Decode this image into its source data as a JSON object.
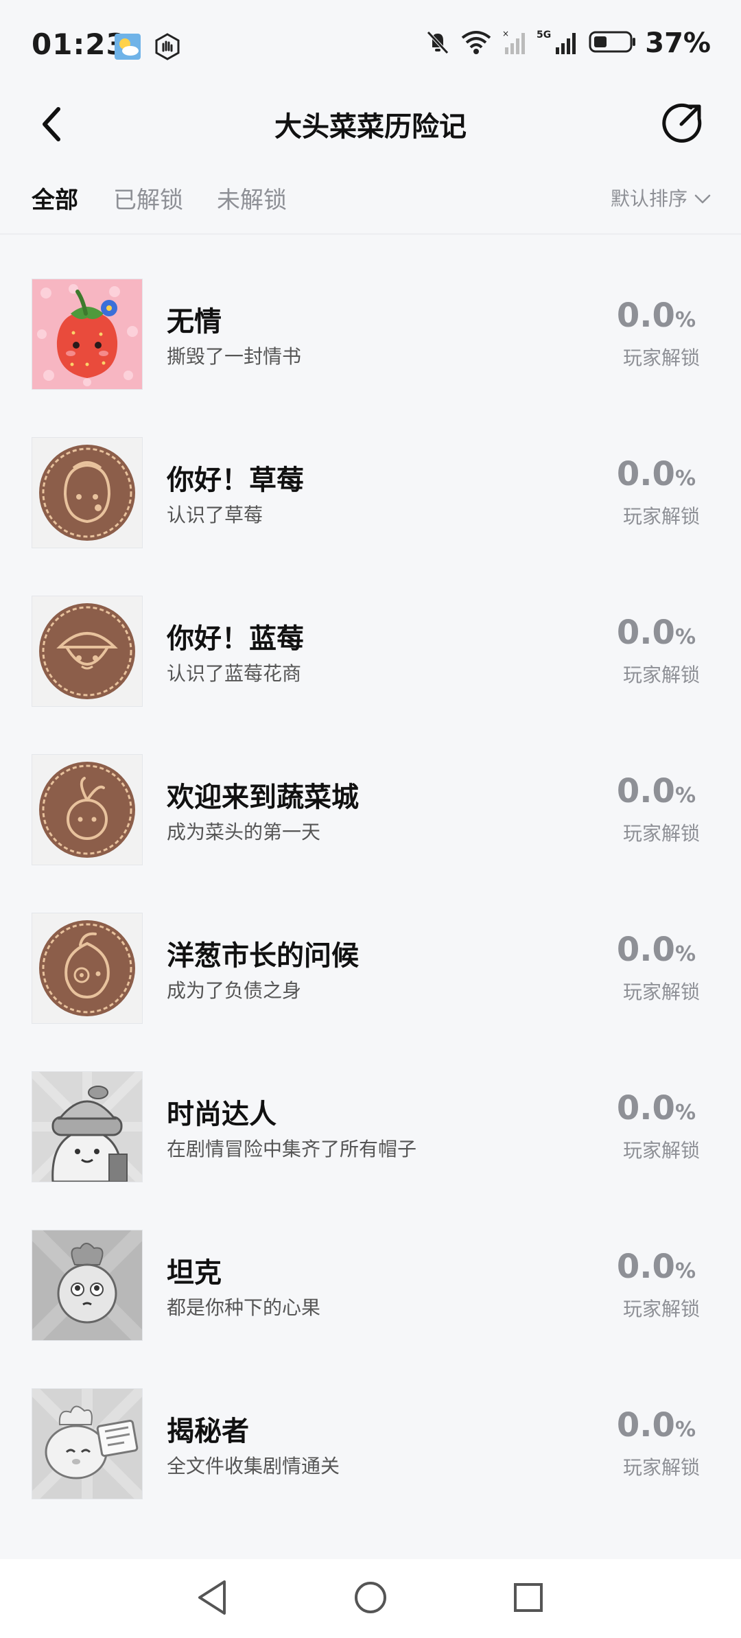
{
  "status_bar": {
    "time": "01:23",
    "battery": "37%",
    "network": "5G"
  },
  "header": {
    "title": "大头菜菜历险记"
  },
  "tabs": [
    {
      "label": "全部",
      "active": true
    },
    {
      "label": "已解锁",
      "active": false
    },
    {
      "label": "未解锁",
      "active": false
    }
  ],
  "sort": {
    "label": "默认排序"
  },
  "achievements": [
    {
      "title": "无情",
      "desc": "撕毁了一封情书",
      "pct": "0.0",
      "unit": "%",
      "sub": "玩家解锁",
      "icon": "strawberry-icon"
    },
    {
      "title": "你好！草莓",
      "desc": "认识了草莓",
      "pct": "0.0",
      "unit": "%",
      "sub": "玩家解锁",
      "icon": "strawberry-badge-icon"
    },
    {
      "title": "你好！蓝莓",
      "desc": "认识了蓝莓花商",
      "pct": "0.0",
      "unit": "%",
      "sub": "玩家解锁",
      "icon": "blueberry-badge-icon"
    },
    {
      "title": "欢迎来到蔬菜城",
      "desc": "成为菜头的第一天",
      "pct": "0.0",
      "unit": "%",
      "sub": "玩家解锁",
      "icon": "turnip-badge-icon"
    },
    {
      "title": "洋葱市长的问候",
      "desc": "成为了负债之身",
      "pct": "0.0",
      "unit": "%",
      "sub": "玩家解锁",
      "icon": "onion-badge-icon"
    },
    {
      "title": "时尚达人",
      "desc": "在剧情冒险中集齐了所有帽子",
      "pct": "0.0",
      "unit": "%",
      "sub": "玩家解锁",
      "icon": "hat-character-icon"
    },
    {
      "title": "坦克",
      "desc": "都是你种下的心果",
      "pct": "0.0",
      "unit": "%",
      "sub": "玩家解锁",
      "icon": "tank-character-icon"
    },
    {
      "title": "揭秘者",
      "desc": "全文件收集剧情通关",
      "pct": "0.0",
      "unit": "%",
      "sub": "玩家解锁",
      "icon": "document-character-icon"
    }
  ],
  "colors": {
    "background": "#f6f7f9",
    "text_primary": "#111111",
    "text_muted": "#8e9096",
    "badge_brown": "#8c5e4a",
    "badge_cream": "#e8c29d"
  }
}
